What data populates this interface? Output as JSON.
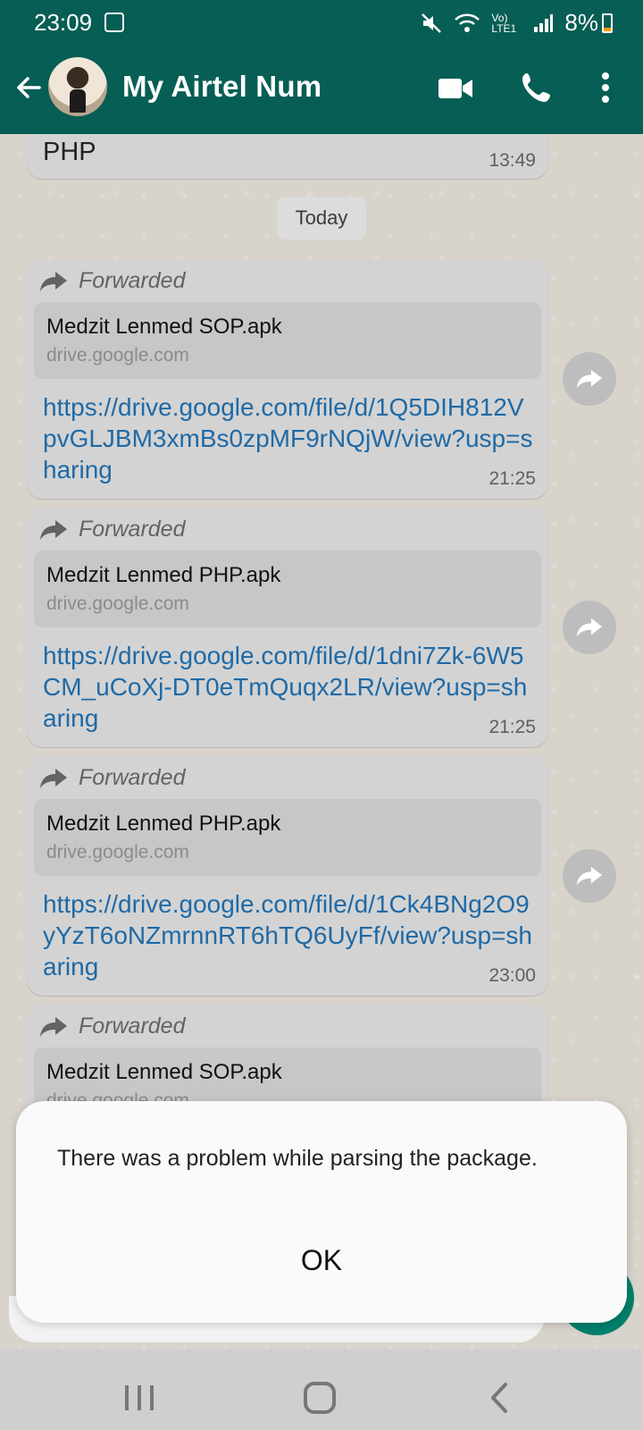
{
  "status_bar": {
    "time": "23:09",
    "battery": "8%",
    "signal_text": "Vo) LTE1"
  },
  "header": {
    "contact_name": "My Airtel Num"
  },
  "chat": {
    "previous_message": {
      "text": "PHP",
      "time": "13:49"
    },
    "date_chip": "Today",
    "messages": [
      {
        "forwarded_label": "Forwarded",
        "preview_title": "Medzit Lenmed SOP.apk",
        "preview_domain": "drive.google.com",
        "link": "https://drive.google.com/file/d/1Q5DIH812VpvGLJBM3xmBs0zpMF9rNQjW/view?usp=sharing",
        "time": "21:25"
      },
      {
        "forwarded_label": "Forwarded",
        "preview_title": "Medzit Lenmed PHP.apk",
        "preview_domain": "drive.google.com",
        "link": "https://drive.google.com/file/d/1dni7Zk-6W5CM_uCoXj-DT0eTmQuqx2LR/view?usp=sharing",
        "time": "21:25"
      },
      {
        "forwarded_label": "Forwarded",
        "preview_title": "Medzit Lenmed PHP.apk",
        "preview_domain": "drive.google.com",
        "link": "https://drive.google.com/file/d/1Ck4BNg2O9yYzT6oNZmrnnRT6hTQ6UyFf/view?usp=sharing",
        "time": "23:00"
      },
      {
        "forwarded_label": "Forwarded",
        "preview_title": "Medzit Lenmed SOP.apk",
        "preview_domain": "drive.google.com"
      }
    ]
  },
  "dialog": {
    "message": "There was a problem while parsing the package.",
    "ok_label": "OK"
  },
  "colors": {
    "header_bg": "#075e54",
    "link": "#1f6aa6",
    "bubble_bg": "#d3d3d3"
  }
}
